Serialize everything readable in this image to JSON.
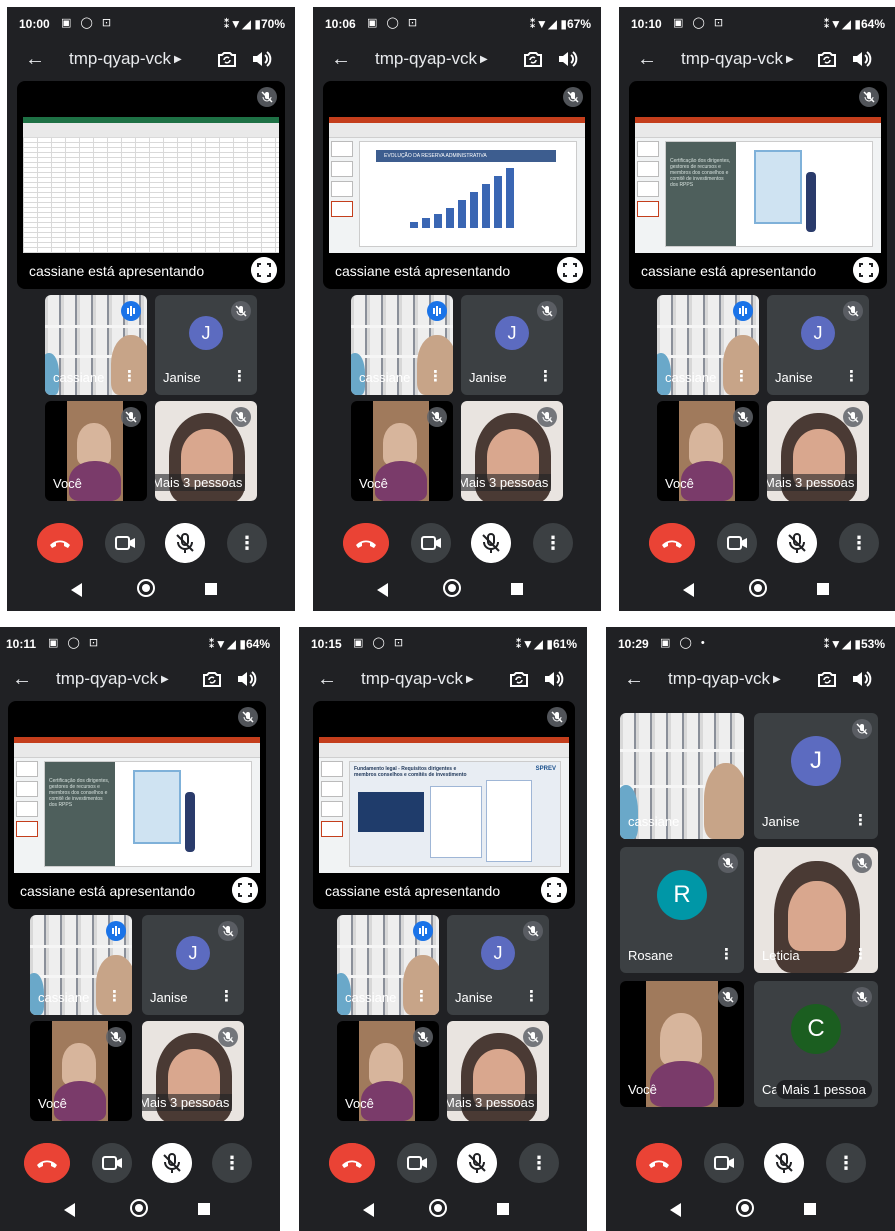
{
  "common": {
    "meeting_code": "tmp-qyap-vck",
    "presenting_caption": "cassiane está apresentando",
    "you_label": "Você",
    "more_options_glyph": "⋮",
    "icons": {
      "back": "arrow-left-icon",
      "caret": "caret-right-icon",
      "camera_switch": "camera-switch-icon",
      "speaker": "speaker-icon",
      "mic_off": "mic-off-icon",
      "hangup": "phone-hangup-icon",
      "camera": "videocam-icon",
      "fullscreen": "fullscreen-icon",
      "speaking": "speaking-indicator-icon"
    },
    "colors": {
      "hangup": "#ea4335",
      "accent_blue": "#1a73e8",
      "janise_avatar": "#5c6bc0",
      "rosane_avatar": "#0097a7",
      "c_avatar": "#1b5e20"
    }
  },
  "screens": [
    {
      "time": "10:00",
      "notif": "▣ ◯ ⊡",
      "right": "⁑▼◢ ▮70%",
      "slide": "excel",
      "p1": {
        "name": "cassiane"
      },
      "p2": {
        "name": "Janise",
        "initial": "J"
      },
      "p4": {
        "name": "Mais 3 pessoas"
      }
    },
    {
      "time": "10:06",
      "notif": "▣ ◯ ⊡",
      "right": "⁑▼◢ ▮67%",
      "slide": "chart",
      "slide_title": "EVOLUÇÃO DA RESERVA ADMINISTRATIVA",
      "p1": {
        "name": "cassiane"
      },
      "p2": {
        "name": "Janise",
        "initial": "J"
      },
      "p4": {
        "name": "Mais 3 pessoas"
      }
    },
    {
      "time": "10:10",
      "notif": "▣ ◯ ⊡",
      "right": "⁑▼◢ ▮64%",
      "slide": "cert",
      "slide_text": "Certificação dos dirigentes, gestores de recursos e membros dos conselhos e comitê de investimentos dos RPPS",
      "p1": {
        "name": "cassiane"
      },
      "p2": {
        "name": "Janise",
        "initial": "J"
      },
      "p4": {
        "name": "Mais 3 pessoas"
      }
    },
    {
      "time": "10:11",
      "notif": "▣ ◯ ⊡",
      "right": "⁑▼◢ ▮64%",
      "slide": "cert",
      "slide_text": "Certificação dos dirigentes, gestores de recursos e membros dos conselhos e comitê de investimentos dos RPPS",
      "p1": {
        "name": "cassiane"
      },
      "p2": {
        "name": "Janise",
        "initial": "J"
      },
      "p4": {
        "name": "Mais 3 pessoas"
      }
    },
    {
      "time": "10:15",
      "notif": "▣ ◯ ⊡",
      "right": "⁑▼◢ ▮61%",
      "slide": "fund",
      "slide_title": "Fundamento legal - Requisitos dirigentes e membros conselhos e comitês de investimento",
      "slide_logo": "SPREV",
      "p1": {
        "name": "cassiane"
      },
      "p2": {
        "name": "Janise",
        "initial": "J"
      },
      "p4": {
        "name": "Mais 3 pessoas"
      }
    },
    {
      "time": "10:29",
      "notif": "▣ ◯ •",
      "right": "⁑▼◢ ▮53%",
      "grid": [
        {
          "name": "cassiane"
        },
        {
          "name": "Janise",
          "initial": "J"
        },
        {
          "name": "Rosane",
          "initial": "R"
        },
        {
          "name": "Leticia"
        },
        {
          "name": "Você"
        },
        {
          "name": "Ca",
          "initial": "C",
          "overlay": "Mais 1 pessoa"
        }
      ]
    }
  ]
}
